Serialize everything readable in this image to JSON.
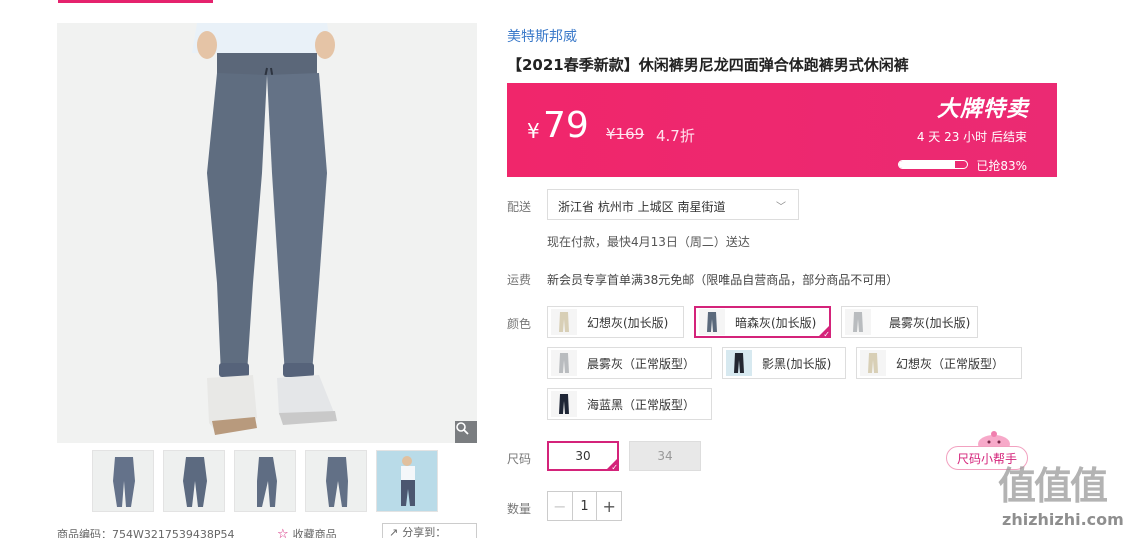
{
  "brand": "美特斯邦威",
  "title": "【2021春季新款】休闲裤男尼龙四面弹合体跑裤男式休闲裤",
  "price": {
    "currency": "¥",
    "current": "79",
    "original": "¥169",
    "discount": "4.7折",
    "promo_label": "大牌特卖",
    "countdown": "4  天 23  小时 后结束",
    "sold_label": "已抢83%",
    "sold_fraction": 0.83
  },
  "delivery": {
    "label": "配送",
    "address": "浙江省 杭州市 上城区 南星街道",
    "note": "现在付款，最快4月13日（周二）送达"
  },
  "freight": {
    "label": "运费",
    "text": "新会员专享首单满38元免邮（限唯品自营商品，部分商品不可用）"
  },
  "colors": {
    "label": "颜色",
    "options": [
      {
        "label": "幻想灰(加长版)",
        "swatch": "#d8cfb6"
      },
      {
        "label": "暗森灰(加长版)",
        "swatch": "#5b6a7c"
      },
      {
        "label": "晨雾灰(加长版)",
        "swatch": "#b9bcbf"
      },
      {
        "label": "晨雾灰（正常版型）",
        "swatch": "#b9bcbf"
      },
      {
        "label": "影黑(加长版)",
        "swatch": "#222630"
      },
      {
        "label": "幻想灰（正常版型）",
        "swatch": "#d8cfb6"
      },
      {
        "label": "海蓝黑（正常版型）",
        "swatch": "#1f2636"
      }
    ]
  },
  "sizes": {
    "label": "尺码",
    "options": [
      {
        "label": "30"
      },
      {
        "label": "34"
      }
    ]
  },
  "size_helper": "尺码小帮手",
  "quantity": {
    "label": "数量",
    "value": "1",
    "minus": "−",
    "plus": "+"
  },
  "meta": {
    "product_code": "商品编码：754W3217539438P54",
    "favorite": "收藏商品",
    "share": "分享到："
  },
  "watermark": {
    "logo": "值值值",
    "url": "zhizhizhi.com"
  }
}
